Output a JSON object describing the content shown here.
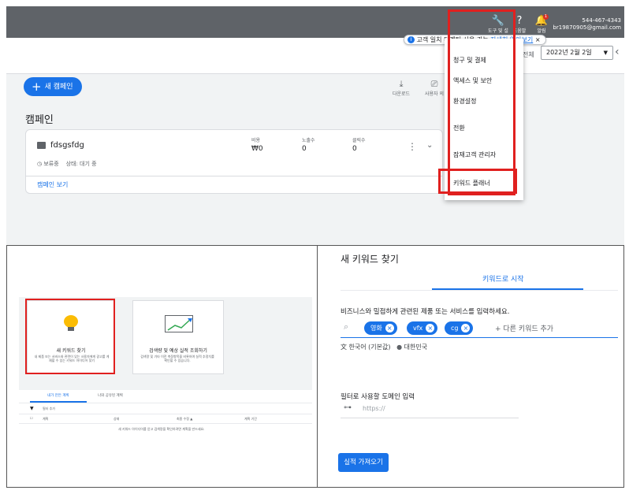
{
  "top_panel": {
    "toolbar": {
      "tools_label": "도구 및 설",
      "help_label": "도움말",
      "notifications_label": "알림",
      "notifications_badge": "1",
      "account_phone": "544-467-4343",
      "account_email": "br19870905@gmail.com"
    },
    "tooltip": {
      "text": "고객 일치 타겟팅 사용 가능",
      "link": "자세히 알아보기",
      "close": "×"
    },
    "strip": {
      "transition_fragment": "전환",
      "range_label": "전체",
      "date_value": "2022년 2월 2일",
      "prev_arrow": "‹"
    },
    "new_campaign_label": "새 캠페인",
    "actions": [
      {
        "label": "다운로드",
        "icon": "download-icon"
      },
      {
        "label": "사용자 의",
        "icon": "feedback-icon"
      }
    ],
    "campaigns_title": "캠페인",
    "campaign": {
      "name": "fdsgsfdg",
      "paused_label": "보류중",
      "status_label": "상태: 대기 중",
      "metrics": [
        {
          "label": "비용",
          "value": "₩0"
        },
        {
          "label": "노출수",
          "value": "0"
        },
        {
          "label": "클릭수",
          "value": "0"
        }
      ],
      "view_link": "캠페인 보기"
    },
    "dropdown_menu": [
      "청구 및 결제",
      "액세스 및 보안",
      "환경설정",
      "전환",
      "잠재고객 관리자",
      "키워드 플래너"
    ]
  },
  "bottom_left": {
    "card_new_keywords": {
      "title": "새 키워드 찾기",
      "desc": "내 제품 또는 서비스와 관련이 있는 사용자에게 광고를 게재할 수 있는 키워드 아이디어 찾기"
    },
    "card_forecast": {
      "title": "검색량 및 예상 실적 조회하기",
      "desc": "검색량 및 기타 이전 측정항목을 비롯하여 실적 추정치를 확인할 수 있습니다."
    },
    "tabs": [
      "내가 만든 계획",
      "나와 공유된 계획"
    ],
    "filter_label": "필터 추가",
    "columns": [
      "계획",
      "상태",
      "최종 수정 ▲",
      "계획 기간"
    ],
    "empty_text": "새 키워드 아이디어를 얻고 검색량을 확인하려면 계획을 만드세요."
  },
  "bottom_right": {
    "title": "새 키워드 찾기",
    "tab": "키워드로 시작",
    "prompt": "비즈니스와 밀접하게 관련된 제품 또는 서비스를 입력하세요.",
    "chips": [
      "영화",
      "vfx",
      "cg"
    ],
    "search_placeholder": "+ 다른 키워드 추가",
    "language": "한국어 (기본값)",
    "location": "대한민국",
    "domain_label": "필터로 사용할 도메인 입력",
    "domain_placeholder": "https://",
    "submit_label": "실적 가져오기"
  },
  "colors": {
    "accent": "#1a73e8",
    "highlight_red": "#e0201f",
    "toolbar_gray": "#5f6368"
  }
}
